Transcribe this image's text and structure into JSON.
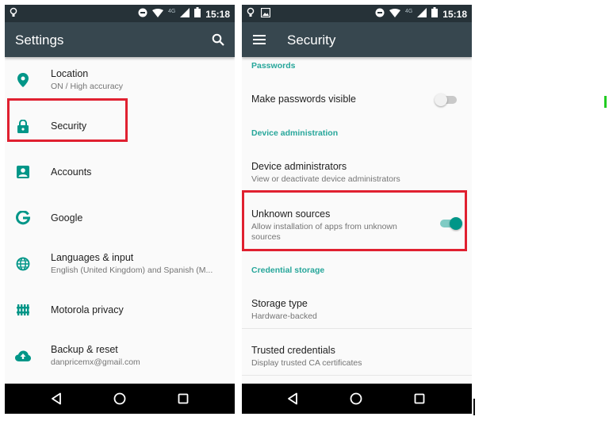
{
  "status_bar": {
    "time": "15:18",
    "network": "4G"
  },
  "left_screen": {
    "title": "Settings",
    "items": [
      {
        "icon": "location-icon",
        "title": "Location",
        "subtitle": "ON / High accuracy"
      },
      {
        "icon": "lock-icon",
        "title": "Security",
        "subtitle": ""
      },
      {
        "icon": "account-icon",
        "title": "Accounts",
        "subtitle": ""
      },
      {
        "icon": "google-icon",
        "title": "Google",
        "subtitle": ""
      },
      {
        "icon": "globe-icon",
        "title": "Languages & input",
        "subtitle": "English (United Kingdom) and Spanish (M..."
      },
      {
        "icon": "privacy-icon",
        "title": "Motorola privacy",
        "subtitle": ""
      },
      {
        "icon": "backup-icon",
        "title": "Backup & reset",
        "subtitle": "danpricemx@gmail.com"
      }
    ]
  },
  "right_screen": {
    "title": "Security",
    "categories": {
      "passwords": "Passwords",
      "device_admin": "Device administration",
      "credential": "Credential storage"
    },
    "items": {
      "make_passwords": {
        "title": "Make passwords visible",
        "enabled": false
      },
      "device_admins": {
        "title": "Device administrators",
        "subtitle": "View or deactivate device administrators"
      },
      "unknown_sources": {
        "title": "Unknown sources",
        "subtitle": "Allow installation of apps from unknown sources",
        "enabled": true
      },
      "storage_type": {
        "title": "Storage type",
        "subtitle": "Hardware-backed"
      },
      "trusted_credentials": {
        "title": "Trusted credentials",
        "subtitle": "Display trusted CA certificates"
      }
    }
  },
  "colors": {
    "toolbar": "#37474f",
    "status_bar": "#263238",
    "accent": "#009688",
    "highlight": "#e02030"
  }
}
